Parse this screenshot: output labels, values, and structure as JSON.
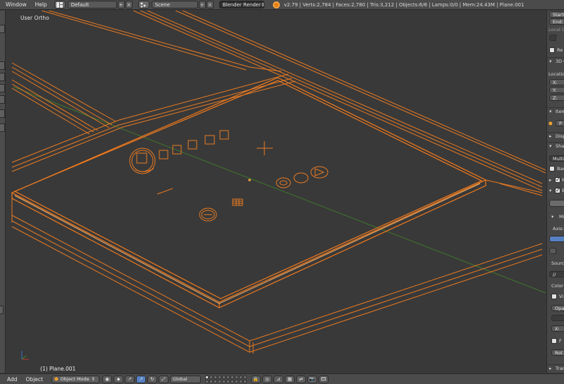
{
  "top_header": {
    "menus": [
      "Window",
      "Help"
    ],
    "screen_layout": "Default",
    "scene": "Scene",
    "render_engine": "Blender Render",
    "stats": "v2.79 | Verts:2,784 | Faces:2,780 | Tris:3,212 | Objects:6/6 | Lamps:0/0 | Mem:24.43M | Plane.001"
  },
  "viewport": {
    "view_name": "User Ortho",
    "active_object_label": "(1) Plane.001",
    "colors": {
      "background": "#393939",
      "selection": "#f07a1e",
      "active": "#f5a85a",
      "grid_green": "#3f7a2c"
    }
  },
  "properties_panel": {
    "rows": {
      "start": "Start",
      "end": "End:",
      "local": "Local C",
      "render_border": "Re",
      "cursor_section": "3D C",
      "location": "Locatio",
      "x": "X:",
      "y": "Y:",
      "z": "Z:",
      "item_section": "Item",
      "item_name": "P",
      "display_section": "Disp",
      "shading_section": "Shad",
      "multitexture": "Multite",
      "backface": "Bac",
      "matcap": "M",
      "bg_images": "B",
      "mirror_axis": "Axis:",
      "source": "Source",
      "source_path": "//",
      "color": "Color",
      "view_as": "Vi",
      "opacity": "Opa",
      "offset_x": "X:",
      "flip": "F",
      "rotation": "Rot",
      "transform_section": "Tran",
      "bg_sub": "Mi"
    }
  },
  "bottom_header": {
    "menus": [
      "Add",
      "Object"
    ],
    "mode": "Object Mode",
    "transform_orientation": "Global"
  }
}
